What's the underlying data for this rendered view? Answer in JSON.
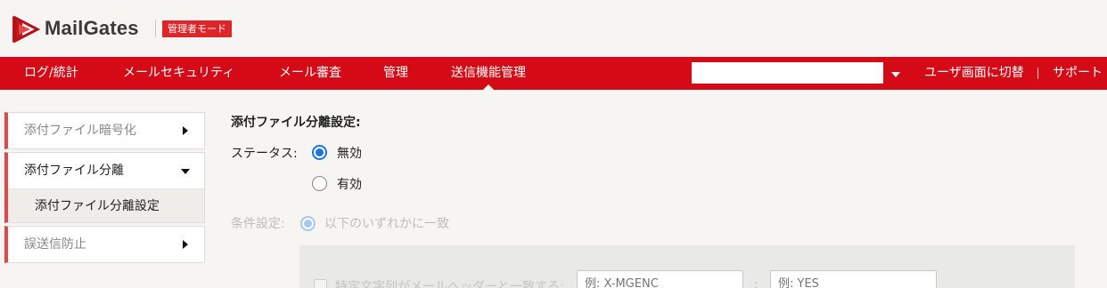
{
  "header": {
    "logo_text": "MailGates",
    "admin_badge": "管理者モード",
    "brand_color": "#d40b17"
  },
  "nav": {
    "items": [
      {
        "label": "ログ/統計"
      },
      {
        "label": "メールセキュリティ"
      },
      {
        "label": "メール審査"
      },
      {
        "label": "管理"
      },
      {
        "label": "送信機能管理",
        "active": true
      }
    ],
    "search_value": "",
    "switch_user_label": "ユーザ画面に切替",
    "support_label": "サポート"
  },
  "sidebar": {
    "groups": [
      {
        "label": "添付ファイル暗号化",
        "expanded": false
      },
      {
        "label": "添付ファイル分離",
        "expanded": true,
        "children": [
          {
            "label": "添付ファイル分離設定"
          }
        ]
      },
      {
        "label": "誤送信防止",
        "expanded": false
      }
    ]
  },
  "main": {
    "section_title": "添付ファイル分離設定:",
    "status": {
      "label": "ステータス:",
      "options": [
        {
          "label": "無効",
          "checked": true
        },
        {
          "label": "有効",
          "checked": false
        }
      ]
    },
    "condition": {
      "label": "条件設定:",
      "option_label": "以下のいずれかに一致",
      "header_match_label": "特定文字列がメールヘッダーと一致する:",
      "header_name_placeholder": "例: X-MGENC",
      "separator": ":",
      "header_value_placeholder": "例: YES"
    }
  }
}
